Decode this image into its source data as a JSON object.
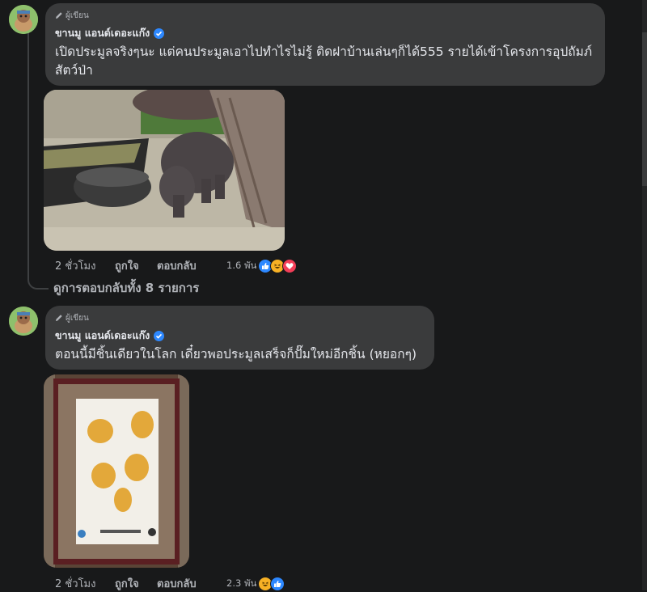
{
  "comments": [
    {
      "author_badge": "ผู้เขียน",
      "author_name": "ขานมู แอนด์เดอะแก๊ง",
      "text_line1": "เปิดประมูลจริงๆนะ แต่คนประมูลเอาไปทำไรไม่รู้ ติดฝาบ้านเล่นๆก็ได้555 รายได้เข้าโครงการอุปถัมภ์",
      "text_line2": "สัตว์ป่า",
      "time": "2 ชั่วโมง",
      "like_label": "ถูกใจ",
      "reply_label": "ตอบกลับ",
      "reaction_count": "1.6 พัน",
      "reactions": [
        "like-icon",
        "haha-icon",
        "love-icon"
      ]
    },
    {
      "author_badge": "ผู้เขียน",
      "author_name": "ขานมู แอนด์เดอะแก๊ง",
      "text_line1": "ตอนนี้มีชิ้นเดียวในโลก เดี๋ยวพอประมูลเสร็จก็ปั๊มใหม่อีกชิ้น (หยอกๆ)",
      "time": "2 ชั่วโมง",
      "like_label": "ถูกใจ",
      "reply_label": "ตอบกลับ",
      "reaction_count": "2.3 พัน",
      "reactions": [
        "haha-icon",
        "like-icon"
      ]
    }
  ],
  "view_replies": "ดูการตอบกลับทั้ง 8 รายการ",
  "colors": {
    "background": "#18191a",
    "bubble": "#3a3b3c",
    "text": "#e4e6eb",
    "secondary_text": "#b0b3b8",
    "verified": "#2d88ff",
    "like": "#2d88ff",
    "love": "#f33e58",
    "haha": "#f7b125"
  }
}
